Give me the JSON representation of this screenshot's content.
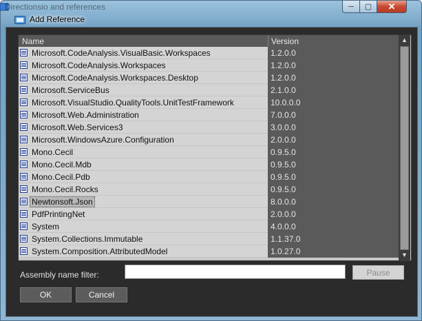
{
  "background_window": {
    "title": "Directionsio and references"
  },
  "dialog": {
    "title": "Add Reference",
    "controls": {
      "minimize": "─",
      "maximize": "▢",
      "close": "✕"
    }
  },
  "table": {
    "columns": {
      "name": "Name",
      "version": "Version"
    },
    "rows": [
      {
        "name": "Microsoft.CodeAnalysis.VisualBasic.Workspaces",
        "version": "1.2.0.0",
        "selected": false
      },
      {
        "name": "Microsoft.CodeAnalysis.Workspaces",
        "version": "1.2.0.0",
        "selected": false
      },
      {
        "name": "Microsoft.CodeAnalysis.Workspaces.Desktop",
        "version": "1.2.0.0",
        "selected": false
      },
      {
        "name": "Microsoft.ServiceBus",
        "version": "2.1.0.0",
        "selected": false
      },
      {
        "name": "Microsoft.VisualStudio.QualityTools.UnitTestFramework",
        "version": "10.0.0.0",
        "selected": false
      },
      {
        "name": "Microsoft.Web.Administration",
        "version": "7.0.0.0",
        "selected": false
      },
      {
        "name": "Microsoft.Web.Services3",
        "version": "3.0.0.0",
        "selected": false
      },
      {
        "name": "Microsoft.WindowsAzure.Configuration",
        "version": "2.0.0.0",
        "selected": false
      },
      {
        "name": "Mono.Cecil",
        "version": "0.9.5.0",
        "selected": false
      },
      {
        "name": "Mono.Cecil.Mdb",
        "version": "0.9.5.0",
        "selected": false
      },
      {
        "name": "Mono.Cecil.Pdb",
        "version": "0.9.5.0",
        "selected": false
      },
      {
        "name": "Mono.Cecil.Rocks",
        "version": "0.9.5.0",
        "selected": false
      },
      {
        "name": "Newtonsoft.Json",
        "version": "8.0.0.0",
        "selected": true
      },
      {
        "name": "PdfPrintingNet",
        "version": "2.0.0.0",
        "selected": false
      },
      {
        "name": "System",
        "version": "4.0.0.0",
        "selected": false
      },
      {
        "name": "System.Collections.Immutable",
        "version": "1.1.37.0",
        "selected": false
      },
      {
        "name": "System.Composition.AttributedModel",
        "version": "1.0.27.0",
        "selected": false
      }
    ]
  },
  "filter": {
    "label": "Assembly name filter:",
    "value": ""
  },
  "buttons": {
    "pause": "Pause",
    "ok": "OK",
    "cancel": "Cancel"
  },
  "colors": {
    "client_bg": "#2b2b2b",
    "name_cell_bg": "#d4d4d4",
    "version_cell_bg": "#5a5a5a",
    "close_button": "#c74a33"
  }
}
